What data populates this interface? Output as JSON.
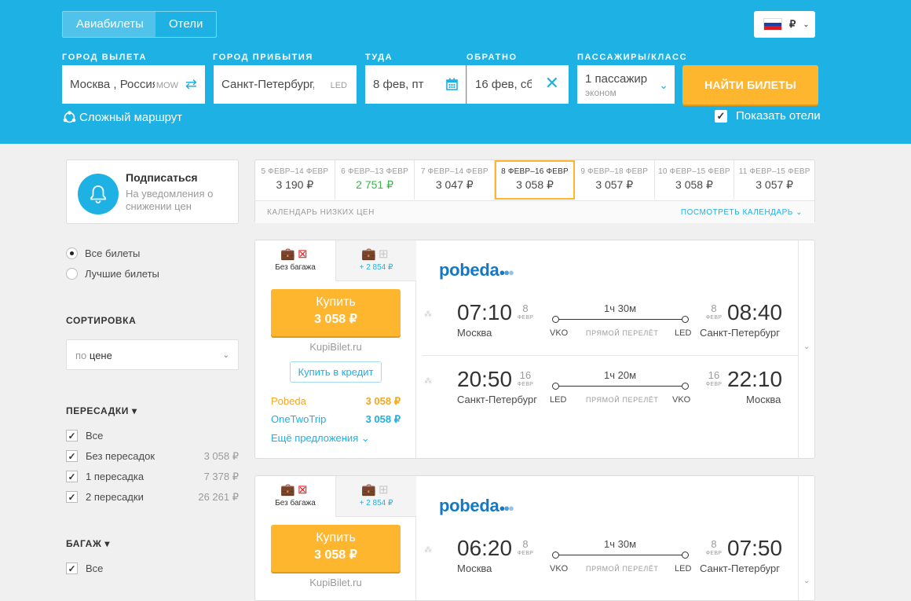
{
  "header": {
    "tabs": [
      {
        "label": "Авиабилеты",
        "active": true
      },
      {
        "label": "Отели",
        "active": false
      }
    ],
    "currency": "₽",
    "form": {
      "origin_label": "ГОРОД ВЫЛЕТА",
      "origin_value": "Москва , Россия",
      "origin_code": "MOW",
      "destination_label": "ГОРОД ПРИБЫТИЯ",
      "destination_value": "Санкт-Петербург, Р",
      "destination_code": "LED",
      "depart_label": "ТУДА",
      "depart_value": "8 фев, пт",
      "return_label": "ОБРАТНО",
      "return_value": "16 фев, сб",
      "passengers_label": "ПАССАЖИРЫ/КЛАСС",
      "passengers_value": "1 пассажир",
      "class_value": "эконом",
      "search_button": "НАЙТИ БИЛЕТЫ"
    },
    "complex_route": "Сложный маршрут",
    "show_hotels": "Показать отели",
    "show_hotels_checked": true
  },
  "subscribe": {
    "title": "Подписаться",
    "description": "На уведомления о снижении цен"
  },
  "calendar": {
    "cells": [
      {
        "dates": "5 ФЕВР–14 ФЕВР",
        "price": "3 190 ₽",
        "cheapest": false,
        "selected": false
      },
      {
        "dates": "6 ФЕВР–13 ФЕВР",
        "price": "2 751 ₽",
        "cheapest": true,
        "selected": false
      },
      {
        "dates": "7 ФЕВР–14 ФЕВР",
        "price": "3 047 ₽",
        "cheapest": false,
        "selected": false
      },
      {
        "dates": "8 ФЕВР–16 ФЕВР",
        "price": "3 058 ₽",
        "cheapest": false,
        "selected": true
      },
      {
        "dates": "9 ФЕВР–18 ФЕВР",
        "price": "3 057 ₽",
        "cheapest": false,
        "selected": false
      },
      {
        "dates": "10 ФЕВР–15 ФЕВР",
        "price": "3 058 ₽",
        "cheapest": false,
        "selected": false
      },
      {
        "dates": "11 ФЕВР–15 ФЕВР",
        "price": "3 057 ₽",
        "cheapest": false,
        "selected": false
      }
    ],
    "footer_left": "КАЛЕНДАРЬ НИЗКИХ ЦЕН",
    "footer_right": "ПОСМОТРЕТЬ КАЛЕНДАРЬ ⌄"
  },
  "filters": {
    "tickets": [
      {
        "label": "Все билеты",
        "selected": true
      },
      {
        "label": "Лучшие билеты",
        "selected": false
      }
    ],
    "sort_title": "СОРТИРОВКА",
    "sort_prefix": "по",
    "sort_value": "цене",
    "transfers_title": "ПЕРЕСАДКИ ▾",
    "transfers": [
      {
        "label": "Все",
        "price": "",
        "checked": true
      },
      {
        "label": "Без пересадок",
        "price": "3 058 ₽",
        "checked": true
      },
      {
        "label": "1 пересадка",
        "price": "7 378 ₽",
        "checked": true
      },
      {
        "label": "2 пересадки",
        "price": "26 261 ₽",
        "checked": true
      }
    ],
    "baggage_title": "БАГАЖ ▾",
    "baggage": [
      {
        "label": "Все",
        "checked": true
      }
    ]
  },
  "tickets": [
    {
      "no_bag_label": "Без багажа",
      "bag_extra": "+ 2 854 ₽",
      "buy_label": "Купить",
      "price": "3 058 ₽",
      "agency": "KupiBilet.ru",
      "credit": "Купить в кредит",
      "offers": [
        {
          "name": "Pobeda",
          "price": "3 058 ₽",
          "color": "#f5a623"
        },
        {
          "name": "OneTwoTrip",
          "price": "3 058 ₽",
          "color": "#1eb1e3"
        }
      ],
      "more": "Ещё предложения ⌄",
      "airline": "pobeda",
      "segments": [
        {
          "dep_time": "07:10",
          "dep_day": "8",
          "dep_month": "ФЕВР",
          "dep_city": "Москва",
          "dep_code": "VKO",
          "duration": "1ч 30м",
          "type": "ПРЯМОЙ ПЕРЕЛЁТ",
          "arr_code": "LED",
          "arr_time": "08:40",
          "arr_day": "8",
          "arr_month": "ФЕВР",
          "arr_city": "Санкт-Петербург"
        },
        {
          "dep_time": "20:50",
          "dep_day": "16",
          "dep_month": "ФЕВР",
          "dep_city": "Санкт-Петербург",
          "dep_code": "LED",
          "duration": "1ч 20м",
          "type": "ПРЯМОЙ ПЕРЕЛЁТ",
          "arr_code": "VKO",
          "arr_time": "22:10",
          "arr_day": "16",
          "arr_month": "ФЕВР",
          "arr_city": "Москва"
        }
      ]
    },
    {
      "no_bag_label": "Без багажа",
      "bag_extra": "+ 2 854 ₽",
      "buy_label": "Купить",
      "price": "3 058 ₽",
      "agency": "KupiBilet.ru",
      "airline": "pobeda",
      "segments": [
        {
          "dep_time": "06:20",
          "dep_day": "8",
          "dep_month": "ФЕВР",
          "dep_city": "Москва",
          "dep_code": "VKO",
          "duration": "1ч 30м",
          "type": "ПРЯМОЙ ПЕРЕЛЁТ",
          "arr_code": "LED",
          "arr_time": "07:50",
          "arr_day": "8",
          "arr_month": "ФЕВР",
          "arr_city": "Санкт-Петербург"
        }
      ]
    }
  ],
  "colors": {
    "brand": "#1eb1e3",
    "accent": "#ffb62f",
    "airline": "#1379c4",
    "cheap": "#3cb54a"
  }
}
